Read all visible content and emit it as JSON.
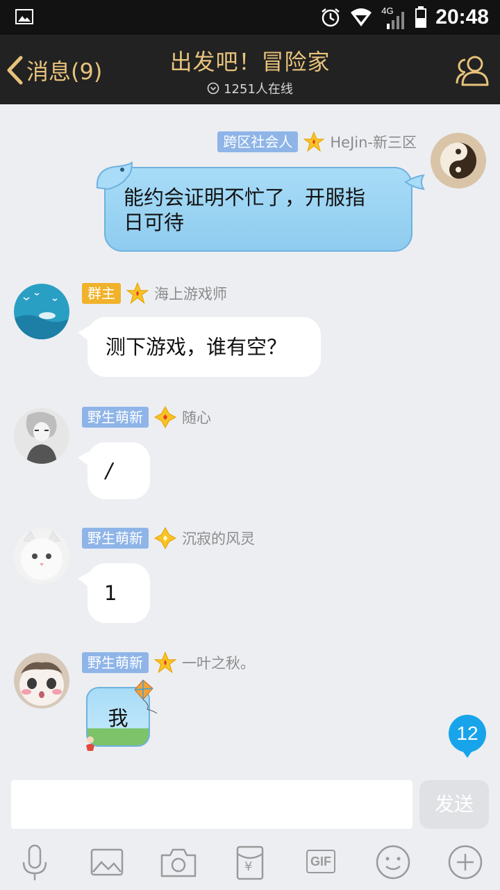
{
  "status_bar": {
    "time": "20:48",
    "network": "4G"
  },
  "header": {
    "back_label": "消息(9)",
    "title": "出发吧！冒险家",
    "online": "1251人在线"
  },
  "messages": [
    {
      "side": "right",
      "badge": "跨区社会人",
      "username": "HeJin-新三区",
      "text_line1": "能约会证明不忙了，开服指",
      "text_line2": "日可待"
    },
    {
      "side": "left",
      "badge": "群主",
      "username": "海上游戏师",
      "text": "测下游戏，谁有空？"
    },
    {
      "side": "left",
      "badge": "野生萌新",
      "username": "随心",
      "text": "/"
    },
    {
      "side": "left",
      "badge": "野生萌新",
      "username": "沉寂的风灵",
      "text": "1"
    },
    {
      "side": "left",
      "badge": "野生萌新",
      "username": "一叶之秋。",
      "text": "我"
    }
  ],
  "unread_count": "12",
  "input": {
    "value": "",
    "placeholder": "",
    "send_label": "发送"
  },
  "toolbar": {
    "items": [
      "mic-icon",
      "image-icon",
      "camera-icon",
      "red-packet-icon",
      "gif-icon",
      "emoji-icon",
      "plus-icon"
    ],
    "gif_label": "GIF",
    "yen_label": "¥"
  },
  "colors": {
    "header_bg": "#222222",
    "header_accent": "#e8c37c",
    "badge_blue": "#8fb5e8",
    "badge_gold": "#f0b22a",
    "unread_blue": "#18a4ea",
    "self_bubble": "#9fd6f4"
  }
}
